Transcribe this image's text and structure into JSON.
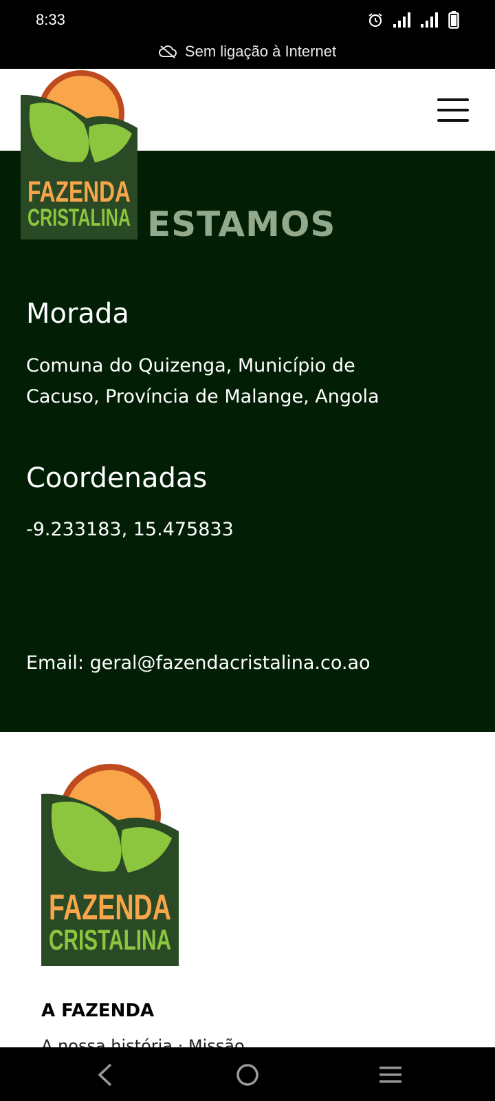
{
  "status_bar": {
    "time": "8:33",
    "offline_text": "Sem ligação à Internet",
    "icons": [
      "alarm-icon",
      "signal-icon",
      "signal-icon",
      "battery-icon"
    ]
  },
  "header": {
    "logo": {
      "line1": "FAZENDA",
      "line2": "CRISTALINA"
    },
    "menu_icon": "hamburger-menu-icon"
  },
  "contact": {
    "heading_partial": "ESTAMOS",
    "address_title": "Morada",
    "address_line1": "Comuna do Quizenga, Município de",
    "address_line2": "Cacuso, Província de Malange, Angola",
    "coords_title": "Coordenadas",
    "coords_value": "-9.233183, 15.475833",
    "email": "Email: geral@fazendacristalina.co.ao"
  },
  "footer": {
    "logo": {
      "line1": "FAZENDA",
      "line2": "CRISTALINA"
    },
    "section_title": "A FAZENDA",
    "partial_text": "A nossa história · Missão"
  },
  "nav_bar": {
    "icons": [
      "back-icon",
      "home-icon",
      "recents-icon"
    ]
  },
  "colors": {
    "dark_green": "#021f05",
    "logo_green": "#2a4a26",
    "leaf_green": "#8cc63f",
    "sun_orange": "#f9a54a",
    "sun_rim": "#c04a20",
    "heading_muted": "#93a98b"
  }
}
